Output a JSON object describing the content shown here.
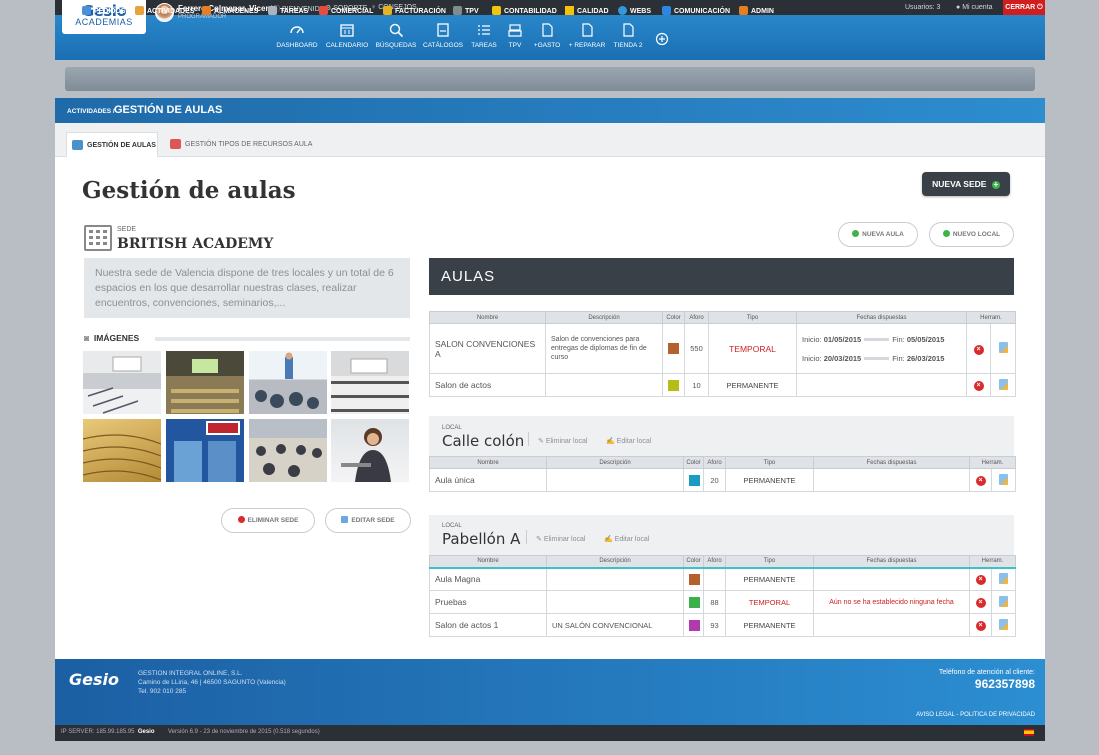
{
  "header": {
    "logo": "Gesio",
    "logo_sub": "ACADEMIAS",
    "user_name": "Ferrero Colmenar, Vicente",
    "user_role": "PROGRAMADOR",
    "links": [
      "BIENVENIDA",
      "SOPORTE",
      "CONSEJOS"
    ],
    "users_count": "Usuarios: 3",
    "my_account": "Mi cuenta",
    "logout": "CERRAR",
    "icons": [
      {
        "label": "DASHBOARD",
        "icon": "gauge-icon"
      },
      {
        "label": "CALENDARIO",
        "icon": "calendar-icon"
      },
      {
        "label": "BÚSQUEDAS",
        "icon": "search-icon"
      },
      {
        "label": "CATÁLOGOS",
        "icon": "catalog-icon"
      },
      {
        "label": "TAREAS",
        "icon": "list-icon"
      },
      {
        "label": "TPV",
        "icon": "register-icon"
      },
      {
        "label": "+GASTO",
        "icon": "document-icon"
      },
      {
        "label": "+ REPARAR",
        "icon": "document-icon"
      },
      {
        "label": "TIENDA 2",
        "icon": "document-icon"
      }
    ]
  },
  "nav": [
    {
      "label": "PEDIDOS",
      "color": "#4a90d9"
    },
    {
      "label": "ACTIVIDADES",
      "color": "#e6a23c"
    },
    {
      "label": "ALMACENES",
      "color": "#e67e22"
    },
    {
      "label": "TAREAS",
      "color": "#aab4be"
    },
    {
      "label": "COMERCIAL",
      "color": "#e74c3c"
    },
    {
      "label": "FACTURACIÓN",
      "color": "#e6b422"
    },
    {
      "label": "TPV",
      "color": "#7f8c8d"
    },
    {
      "label": "CONTABILIDAD",
      "color": "#f1c40f"
    },
    {
      "label": "CALIDAD",
      "color": "#f4c20d"
    },
    {
      "label": "WEBS",
      "color": "#3498db"
    },
    {
      "label": "COMUNICACIÓN",
      "color": "#2e86de"
    },
    {
      "label": "ADMIN",
      "color": "#e67e22"
    }
  ],
  "breadcrumb": {
    "parent": "ACTIVIDADES /",
    "current": "GESTIÓN DE AULAS"
  },
  "tabs": [
    "GESTIÓN DE AULAS",
    "GESTIÓN TIPOS DE RECURSOS AULA"
  ],
  "page_title": "Gestión de aulas",
  "new_sede": "NUEVA SEDE",
  "sede": {
    "label": "SEDE",
    "name": "BRITISH ACADEMY",
    "description": "Nuestra sede de Valencia dispone de tres locales y un total de 6 espacios en los que desarrollar nuestras clases, realizar encuentros, convenciones, seminarios,...",
    "images_label": "IMÁGENES",
    "delete": "ELIMINAR SEDE",
    "edit": "EDITAR SEDE"
  },
  "buttons": {
    "new_aula": "NUEVA AULA",
    "new_local": "NUEVO LOCAL"
  },
  "aulas_title": "AULAS",
  "columns": [
    "Nombre",
    "Descripción",
    "Color",
    "Aforo",
    "Tipo",
    "Fechas dispuestas",
    "Herram."
  ],
  "date_labels": {
    "start": "Inicio:",
    "end": "Fin:"
  },
  "main_rows": [
    {
      "name": "SALON CONVENCIONES A",
      "desc": "Salon de convenciones para entregas de diplomas de fin de curso",
      "color": "#b5602f",
      "aforo": "550",
      "tipo": "TEMPORAL",
      "dates": [
        {
          "start": "01/05/2015",
          "end": "05/05/2015"
        },
        {
          "start": "20/03/2015",
          "end": "26/03/2015"
        }
      ]
    },
    {
      "name": "Salon de actos",
      "desc": "",
      "color": "#b5bd17",
      "aforo": "10",
      "tipo": "PERMANENTE",
      "dates": []
    }
  ],
  "locals": [
    {
      "label": "LOCAL",
      "name": "Calle colón",
      "delete": "Eliminar local",
      "edit": "Editar local",
      "rows": [
        {
          "name": "Aula única",
          "desc": "",
          "color": "#1a9bc1",
          "aforo": "20",
          "tipo": "PERMANENTE",
          "note": ""
        }
      ]
    },
    {
      "label": "LOCAL",
      "name": "Pabellón A",
      "delete": "Eliminar local",
      "edit": "Editar local",
      "rows": [
        {
          "name": "Aula Magna",
          "desc": "",
          "color": "#b5602f",
          "aforo": "",
          "tipo": "PERMANENTE",
          "note": ""
        },
        {
          "name": "Pruebas",
          "desc": "",
          "color": "#3aaf4a",
          "aforo": "88",
          "tipo": "TEMPORAL",
          "note": "Aún no se ha establecido ninguna fecha"
        },
        {
          "name": "Salon de actos 1",
          "desc": "UN SALÓN CONVENCIONAL",
          "color": "#b03aae",
          "aforo": "93",
          "tipo": "PERMANENTE",
          "note": ""
        }
      ]
    }
  ],
  "footer": {
    "logo": "Gesio",
    "company": "GESTION INTEGRAL ONLINE, S.L.",
    "address": "Camino de LLiria, 46 | 46500 SAGUNTO (Valencia)",
    "phone_small": "Tel. 902 010 285",
    "phone_label": "Teléfono de atención al cliente:",
    "phone": "962357898",
    "legal": "AVISO LEGAL - POLITICA DE PRIVACIDAD",
    "server": "IP SERVER: 185.99.185.95",
    "version": "Versión 6.9 - 23 de noviembre de 2015 (0.518 segundos)"
  }
}
